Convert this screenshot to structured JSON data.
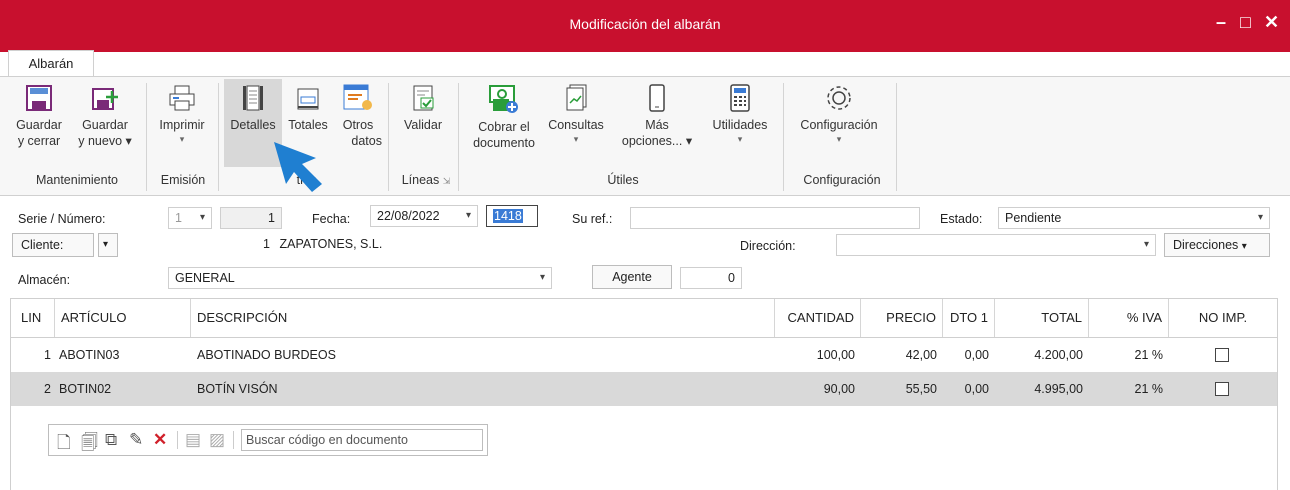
{
  "window": {
    "title": "Modificación del albarán",
    "controls": {
      "minimize": "–",
      "maximize": "□",
      "close": "✕"
    }
  },
  "tabs": [
    {
      "label": "Albarán",
      "active": true
    }
  ],
  "ribbon": {
    "buttons": [
      {
        "name": "guardar-cerrar",
        "line1": "Guardar",
        "line2": "y cerrar"
      },
      {
        "name": "guardar-nuevo",
        "line1": "Guardar",
        "line2": "y nuevo ▾"
      },
      {
        "name": "imprimir",
        "line1": "Imprimir",
        "line2": "▾"
      },
      {
        "name": "detalles",
        "line1": "Detalles",
        "line2": ""
      },
      {
        "name": "totales",
        "line1": "Totales",
        "line2": ""
      },
      {
        "name": "otros-datos",
        "line1": "Otros",
        "line2": "datos"
      },
      {
        "name": "validar",
        "line1": "Validar",
        "line2": ""
      },
      {
        "name": "cobrar",
        "line1": "Cobrar el",
        "line2": "documento"
      },
      {
        "name": "consultas",
        "line1": "Consultas",
        "line2": "▾"
      },
      {
        "name": "mas-opciones",
        "line1": "Más",
        "line2": "opciones... ▾"
      },
      {
        "name": "utilidades",
        "line1": "Utilidades",
        "line2": "▾"
      },
      {
        "name": "configuracion",
        "line1": "Configuración",
        "line2": "▾"
      }
    ],
    "groups": {
      "mantenimiento": "Mantenimiento",
      "emision": "Emisión",
      "mostrar": "trar",
      "lineas": "Líneas",
      "utiles": "Útiles",
      "configuracion": "Configuración"
    }
  },
  "form": {
    "serie_label": "Serie / Número:",
    "serie_value": "1",
    "numero_value": "1",
    "fecha_label": "Fecha:",
    "fecha_value": "22/08/2022",
    "code_value": "1418",
    "suref_label": "Su ref.:",
    "suref_value": "",
    "estado_label": "Estado:",
    "estado_value": "Pendiente",
    "cliente_label": "Cliente:",
    "cliente_code": "1",
    "cliente_name": "ZAPATONES, S.L.",
    "direccion_label": "Dirección:",
    "direccion_value": "",
    "direcciones_button": "Direcciones",
    "almacen_label": "Almacén:",
    "almacen_value": "GENERAL",
    "agente_button": "Agente",
    "agente_value": "0"
  },
  "table": {
    "headers": {
      "lin": "LIN",
      "articulo": "ARTÍCULO",
      "descripcion": "DESCRIPCIÓN",
      "cantidad": "CANTIDAD",
      "precio": "PRECIO",
      "dto1": "DTO 1",
      "total": "TOTAL",
      "iva": "% IVA",
      "noimp": "NO IMP."
    },
    "rows": [
      {
        "lin": "1",
        "articulo": "ABOTIN03",
        "descripcion": "ABOTINADO BURDEOS",
        "cantidad": "100,00",
        "precio": "42,00",
        "dto1": "0,00",
        "total": "4.200,00",
        "iva": "21 %",
        "noimp": false
      },
      {
        "lin": "2",
        "articulo": "BOTIN02",
        "descripcion": "BOTÍN VISÓN",
        "cantidad": "90,00",
        "precio": "55,50",
        "dto1": "0,00",
        "total": "4.995,00",
        "iva": "21 %",
        "noimp": false
      }
    ]
  },
  "line_toolbar": {
    "search_placeholder": "Buscar código en documento"
  },
  "colors": {
    "titlebar": "#c8102e",
    "selected_row": "#d9d9d9",
    "ribbon_bg": "#f7f7f7",
    "cursor_arrow": "#1f7fd1"
  }
}
